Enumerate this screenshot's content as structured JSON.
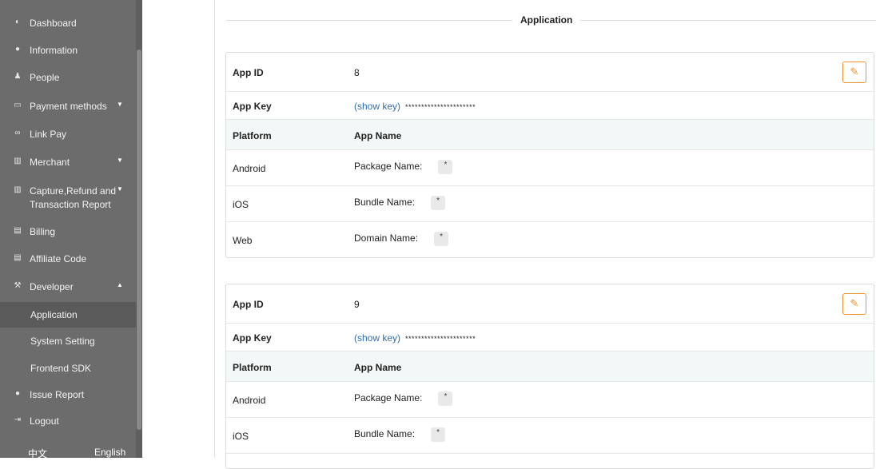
{
  "sidebar": {
    "items": [
      {
        "label": "Dashboard",
        "icon": "dashboard-icon",
        "glyph": "◐"
      },
      {
        "label": "Information",
        "icon": "info-icon",
        "glyph": "●"
      },
      {
        "label": "People",
        "icon": "people-icon",
        "glyph": "♟"
      },
      {
        "label": "Payment methods",
        "icon": "card-icon",
        "glyph": "▭"
      },
      {
        "label": "Link Pay",
        "icon": "link-icon",
        "glyph": "∞"
      },
      {
        "label": "Merchant",
        "icon": "building-icon",
        "glyph": "▥"
      },
      {
        "label": "Capture,Refund and",
        "label2": "Transaction Report",
        "icon": "building-icon",
        "glyph": "▥"
      },
      {
        "label": "Billing",
        "icon": "document-icon",
        "glyph": "▤"
      },
      {
        "label": "Affiliate Code",
        "icon": "document-icon",
        "glyph": "▤"
      },
      {
        "label": "Developer",
        "icon": "wrench-icon",
        "glyph": "⚒"
      },
      {
        "label": "Issue Report",
        "icon": "question-icon",
        "glyph": "●"
      },
      {
        "label": "Logout",
        "icon": "logout-icon",
        "glyph": "⇥"
      }
    ],
    "developer_sub": [
      "Application",
      "System Setting",
      "Frontend SDK"
    ],
    "lang": {
      "zh": "中文",
      "en": "English"
    }
  },
  "main": {
    "section_title": "Application",
    "cards": [
      {
        "app_id_label": "App ID",
        "app_id": "8",
        "app_key_label": "App Key",
        "show_key": "(show key)",
        "key_mask": "**********************",
        "platform_header": "Platform",
        "appname_header": "App Name",
        "rows": [
          {
            "platform": "Android",
            "name_label": "Package Name:",
            "value": "*"
          },
          {
            "platform": "iOS",
            "name_label": "Bundle Name:",
            "value": "*"
          },
          {
            "platform": "Web",
            "name_label": "Domain Name:",
            "value": "*"
          }
        ]
      },
      {
        "app_id_label": "App ID",
        "app_id": "9",
        "app_key_label": "App Key",
        "show_key": "(show key)",
        "key_mask": "**********************",
        "platform_header": "Platform",
        "appname_header": "App Name",
        "rows": [
          {
            "platform": "Android",
            "name_label": "Package Name:",
            "value": "*"
          },
          {
            "platform": "iOS",
            "name_label": "Bundle Name:",
            "value": "*"
          }
        ]
      }
    ],
    "edit_icon": "edit-icon",
    "accent": "#f0922e",
    "link_color": "#2f6fb0"
  }
}
